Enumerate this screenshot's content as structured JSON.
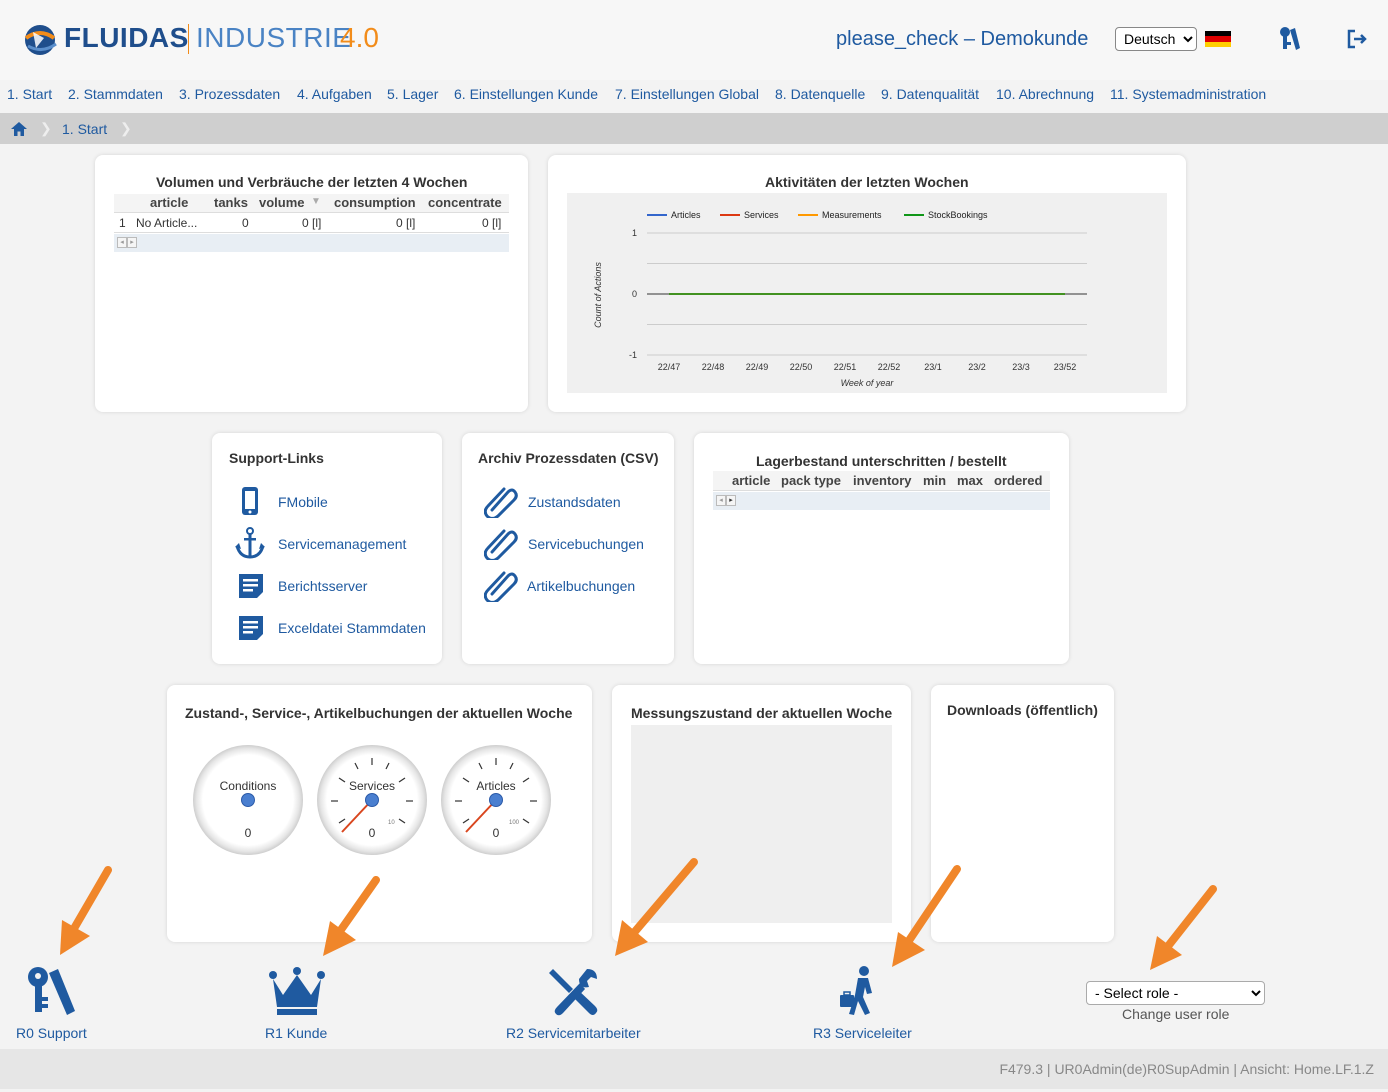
{
  "header": {
    "logo_fluidas": "FLUIDAS",
    "logo_industrie": "INDUSTRIE",
    "logo_version": "4.0",
    "user_title": "please_check – Demokunde",
    "language_select": "Deutsch"
  },
  "nav": [
    "1. Start",
    "2. Stammdaten",
    "3. Prozessdaten",
    "4. Aufgaben",
    "5. Lager",
    "6. Einstellungen Kunde",
    "7. Einstellungen Global",
    "8. Datenquelle",
    "9. Datenqualität",
    "10. Abrechnung",
    "11. Systemadministration"
  ],
  "breadcrumb": {
    "current": "1. Start"
  },
  "volume_card": {
    "title": "Volumen und Verbräuche der letzten 4 Wochen",
    "columns": [
      "article",
      "tanks",
      "volume",
      "consumption",
      "concentrate"
    ],
    "rows": [
      {
        "num": "1",
        "article": "No Article...",
        "tanks": "0",
        "volume": "0 [l]",
        "consumption": "0 [l]",
        "concentrate": "0 [l]"
      }
    ]
  },
  "activity_card": {
    "title": "Aktivitäten der letzten Wochen"
  },
  "chart_data": {
    "type": "line",
    "title": "Aktivitäten der letzten Wochen",
    "xlabel": "Week of year",
    "ylabel": "Count of Actions",
    "categories": [
      "22/47",
      "22/48",
      "22/49",
      "22/50",
      "22/51",
      "22/52",
      "23/1",
      "23/2",
      "23/3",
      "23/52"
    ],
    "yticks": [
      "1",
      "0",
      "-1"
    ],
    "ylim": [
      -1,
      1
    ],
    "legend_position": "top",
    "series": [
      {
        "name": "Articles",
        "color": "#3366cc",
        "values": [
          0,
          0,
          0,
          0,
          0,
          0,
          0,
          0,
          0,
          0
        ]
      },
      {
        "name": "Services",
        "color": "#dc3912",
        "values": [
          0,
          0,
          0,
          0,
          0,
          0,
          0,
          0,
          0,
          0
        ]
      },
      {
        "name": "Measurements",
        "color": "#ff9900",
        "values": [
          0,
          0,
          0,
          0,
          0,
          0,
          0,
          0,
          0,
          0
        ]
      },
      {
        "name": "StockBookings",
        "color": "#109618",
        "values": [
          0,
          0,
          0,
          0,
          0,
          0,
          0,
          0,
          0,
          0
        ]
      }
    ]
  },
  "support_card": {
    "title": "Support-Links",
    "links": [
      "FMobile",
      "Servicemanagement",
      "Berichtsserver",
      "Exceldatei Stammdaten"
    ]
  },
  "archive_card": {
    "title": "Archiv Prozessdaten (CSV)",
    "links": [
      "Zustandsdaten",
      "Servicebuchungen",
      "Artikelbuchungen"
    ]
  },
  "stock_card": {
    "title": "Lagerbestand unterschritten / bestellt",
    "columns": [
      "article",
      "pack type",
      "inventory",
      "min",
      "max",
      "ordered"
    ]
  },
  "bookings_card": {
    "title": "Zustand-, Service-, Artikelbuchungen der aktuellen Woche",
    "gauges": [
      {
        "label": "Conditions",
        "value": "0",
        "max": ""
      },
      {
        "label": "Services",
        "value": "0",
        "max": "10"
      },
      {
        "label": "Articles",
        "value": "0",
        "max": "100"
      }
    ]
  },
  "measure_card": {
    "title": "Messungszustand der aktuellen Woche"
  },
  "downloads_card": {
    "title": "Downloads (öffentlich)"
  },
  "roles": {
    "r0": "R0 Support",
    "r1": "R1 Kunde",
    "r2": "R2 Servicemitarbeiter",
    "r3": "R3 Serviceleiter",
    "select_placeholder": "- Select role -",
    "change_label": "Change user role"
  },
  "colors": {
    "brand": "#1f4e8c",
    "link": "#1f5aa0",
    "accent": "#f28c1a",
    "arrow": "#f0862a"
  },
  "footer": {
    "text": "F479.3 | UR0Admin(de)R0SupAdmin | Ansicht: Home.LF.1.Z"
  }
}
